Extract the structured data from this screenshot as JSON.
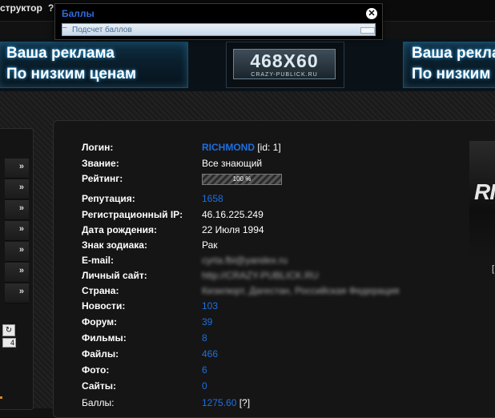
{
  "nav": {
    "constructor": "структор",
    "help": "?"
  },
  "banners": {
    "left": {
      "line1": "Ваша реклама",
      "line2": "По низким ценам"
    },
    "middle": {
      "big": "468X60",
      "small": "CRAZY-PUBLICK.RU"
    },
    "right": {
      "line1": "Ваша рекла",
      "line2": "По низким"
    }
  },
  "popup": {
    "title": "Баллы",
    "close": "✕",
    "progress_label": "Подсчет баллов",
    "progress_dash": "–"
  },
  "left_panel": {
    "chevron": "»",
    "refresh": "↻",
    "page": "4"
  },
  "profile": {
    "login": {
      "label": "Логин:",
      "name": "RICHMOND",
      "id": " [id: 1]"
    },
    "rank": {
      "label": "Звание:",
      "value": "Все знающий"
    },
    "rating": {
      "label": "Рейтинг:",
      "value": "100 %"
    },
    "reputation": {
      "label": "Репутация:",
      "value": "1658"
    },
    "reg_ip": {
      "label": "Регистрационный IP:",
      "value": "46.16.225.249"
    },
    "birthdate": {
      "label": "Дата рождения:",
      "value": "22 Июля 1994"
    },
    "zodiac": {
      "label": "Знак зодиака:",
      "value": "Рак"
    },
    "email": {
      "label": "E-mail:",
      "value": "cyrta.fbi@yandex.ru"
    },
    "site": {
      "label": "Личный сайт:",
      "value": "http://CRAZY-PUBLICK.RU"
    },
    "country": {
      "label": "Страна:",
      "value": "Кизилюрт, Дагестан, Российская Федерация"
    },
    "news": {
      "label": "Новости:",
      "value": "103"
    },
    "forum": {
      "label": "Форум:",
      "value": "39"
    },
    "films": {
      "label": "Фильмы:",
      "value": "8"
    },
    "files": {
      "label": "Файлы:",
      "value": "466"
    },
    "photo": {
      "label": "Фото:",
      "value": "6"
    },
    "sites": {
      "label": "Сайты:",
      "value": "0"
    },
    "points": {
      "label": "Баллы:",
      "value": "1275.60",
      "extra": " [?]"
    }
  },
  "right": {
    "thumb_text": "RICI",
    "bracket": "["
  },
  "colors": {
    "link_blue": "#1e6fe0",
    "popup_title": "#2f6ad7",
    "background": "#121212"
  }
}
